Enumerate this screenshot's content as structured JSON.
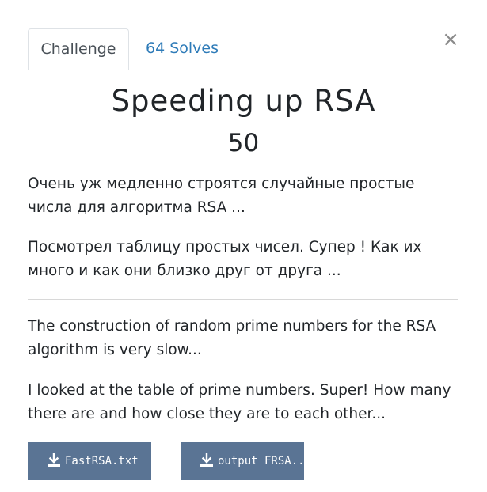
{
  "tabs": [
    {
      "label": "Challenge",
      "active": true
    },
    {
      "label": "64 Solves",
      "active": false
    }
  ],
  "close_glyph": "×",
  "challenge": {
    "title": "Speeding up RSA",
    "points": "50",
    "description": [
      "Очень уж медленно строятся случайные простые числа для алгоритма RSA ...",
      "Посмотрел таблицу простых чисел. Супер ! Как их много и как они близко друг от друга ...",
      "The construction of random prime numbers for the RSA algorithm is very slow...",
      "I looked at the table of prime numbers. Super! How many there are and how close they are to each other..."
    ]
  },
  "files": [
    {
      "label": "FastRSA.txt",
      "icon": "download-icon"
    },
    {
      "label": "output_FRSA...",
      "icon": "download-icon"
    }
  ],
  "colors": {
    "accent_link": "#2e7bb8",
    "file_button_bg": "#5a7494",
    "text": "#212529"
  }
}
